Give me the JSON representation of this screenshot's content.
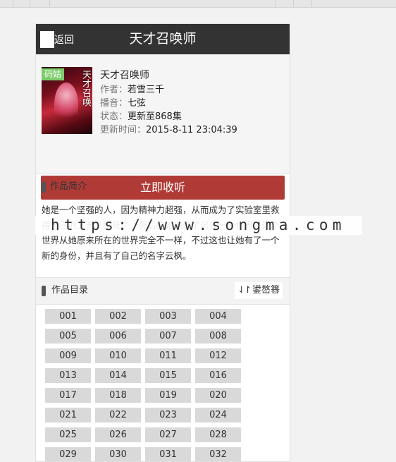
{
  "header": {
    "back_label": "返回",
    "title": "天才召唤师"
  },
  "book": {
    "cover_badge": "码姑",
    "cover_glyphs": "天才召唤",
    "name": "天才召唤师",
    "author_key": "作者：",
    "author": "若雪三千",
    "narrator_key": "播音：",
    "narrator": "七弦",
    "status_key": "状态：",
    "status": "更新至868集",
    "updated_key": "更新时间：",
    "updated": "2015-8-11 23:04:39"
  },
  "listen_button": "立即收听",
  "intro": {
    "title": "作品简介",
    "text": "她是一个坚强的人，因为精神力超强，从而成为了实验室里救得自己的父亲，她死了，死后的她来到了另外一个世界，这个世界从她原来所在的世界完全不一样，不过这也让她有了一个新的身份，并且有了自己的名字云枫。"
  },
  "catalog": {
    "title": "作品目录",
    "sort_label": "鍙嶅簭",
    "episodes": [
      "001",
      "002",
      "003",
      "004",
      "005",
      "006",
      "007",
      "008",
      "009",
      "010",
      "011",
      "012",
      "013",
      "014",
      "015",
      "016",
      "017",
      "018",
      "019",
      "020",
      "021",
      "022",
      "023",
      "024",
      "025",
      "026",
      "027",
      "028",
      "029",
      "030",
      "031",
      "032"
    ]
  },
  "watermark": "https://www.songma.com"
}
